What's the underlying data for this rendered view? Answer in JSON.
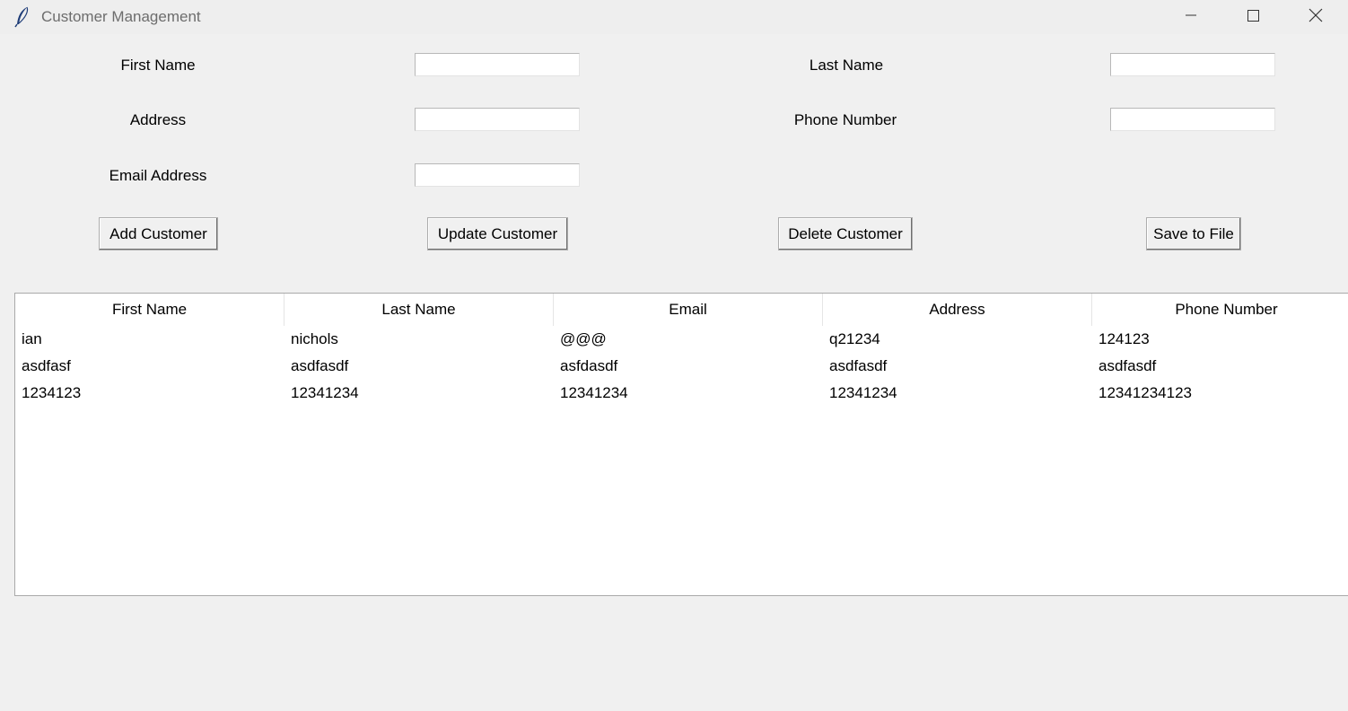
{
  "window": {
    "title": "Customer Management"
  },
  "form": {
    "first_name_label": "First Name",
    "last_name_label": "Last Name",
    "address_label": "Address",
    "phone_label": "Phone Number",
    "email_label": "Email Address",
    "first_name_value": "",
    "last_name_value": "",
    "address_value": "",
    "phone_value": "",
    "email_value": ""
  },
  "buttons": {
    "add": "Add Customer",
    "update": "Update Customer",
    "delete": "Delete Customer",
    "save": "Save to File"
  },
  "table": {
    "columns": [
      "First Name",
      "Last Name",
      "Email",
      "Address",
      "Phone Number"
    ],
    "rows": [
      [
        "ian",
        "nichols",
        "@@@",
        "q21234",
        "124123"
      ],
      [
        "asdfasf",
        "asdfasdf",
        "asfdasdf",
        "asdfasdf",
        "asdfasdf"
      ],
      [
        "1234123",
        "12341234",
        "12341234",
        "12341234",
        "12341234123"
      ]
    ]
  },
  "icons": {
    "app": "feather-icon",
    "minimize": "minimize-icon",
    "maximize": "maximize-icon",
    "close": "close-icon"
  }
}
